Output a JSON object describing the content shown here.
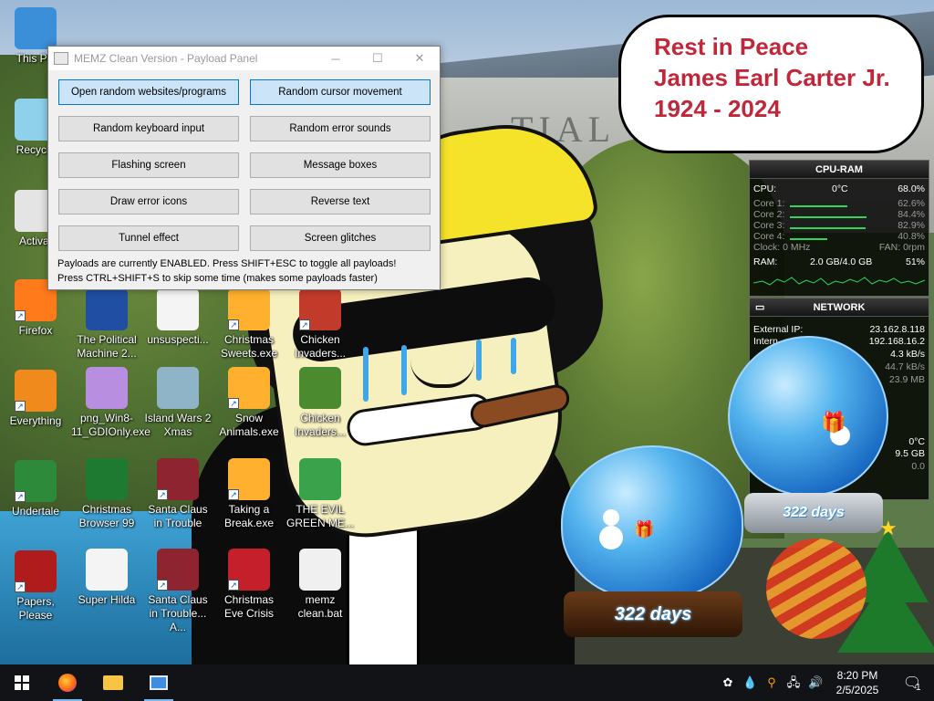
{
  "wallpaper": {
    "building_text": "TIAL",
    "bubble_lines": [
      "Rest in Peace",
      "James Earl Carter Jr.",
      "1924 - 2024"
    ]
  },
  "window": {
    "title": "MEMZ Clean Version - Payload Panel",
    "buttons": [
      {
        "label": "Open random websites/programs",
        "active": true
      },
      {
        "label": "Random cursor movement",
        "active": true
      },
      {
        "label": "Random keyboard input",
        "active": false
      },
      {
        "label": "Random error sounds",
        "active": false
      },
      {
        "label": "Flashing screen",
        "active": false
      },
      {
        "label": "Message boxes",
        "active": false
      },
      {
        "label": "Draw error icons",
        "active": false
      },
      {
        "label": "Reverse text",
        "active": false
      },
      {
        "label": "Tunnel effect",
        "active": false
      },
      {
        "label": "Screen glitches",
        "active": false
      }
    ],
    "status_line_1": "Payloads are currently ENABLED. Press SHIFT+ESC to toggle all payloads!",
    "status_line_2": "Press CTRL+SHIFT+S to skip some time (makes some payloads faster)"
  },
  "desktop_icons": [
    {
      "label": "This PC",
      "color": "#3a8fd8"
    },
    {
      "label": "Recycle",
      "color": "#8fd0ea"
    },
    {
      "label": "Activat",
      "color": "#e4e4e4"
    },
    {
      "label": "Firefox",
      "color": "#ff7a1a"
    },
    {
      "label": "Everything",
      "color": "#f08a1c"
    },
    {
      "label": "Undertale",
      "color": "#2d8a3a"
    },
    {
      "label": "Papers, Please",
      "color": "#b01c1c"
    },
    {
      "label": "The Political Machine 2...",
      "color": "#1f4ea3"
    },
    {
      "label": "unsuspecti...",
      "color": "#f4f4f4"
    },
    {
      "label": "Christmas Sweets.exe",
      "color": "#ffb02e"
    },
    {
      "label": "Chicken Invaders...",
      "color": "#c23b2a"
    },
    {
      "label": "png_Win8-11_GDIOnly.exe",
      "color": "#b78ee0"
    },
    {
      "label": "Island Wars 2 Xmas",
      "color": "#8fb4c8"
    },
    {
      "label": "Snow Animals.exe",
      "color": "#ffb02e"
    },
    {
      "label": "Chicken Invaders...",
      "color": "#4c8a2f"
    },
    {
      "label": "Christmas Browser 99",
      "color": "#1e7a30"
    },
    {
      "label": "Santa Claus in Trouble",
      "color": "#8f2431"
    },
    {
      "label": "Taking a Break.exe",
      "color": "#ffb02e"
    },
    {
      "label": "THE EVIL GREEN ME...",
      "color": "#3aa24b"
    },
    {
      "label": "Super Hilda",
      "color": "#f4f4f4"
    },
    {
      "label": "Santa Claus in Trouble... A...",
      "color": "#8f2431"
    },
    {
      "label": "Christmas Eve Crisis",
      "color": "#c41f2a"
    },
    {
      "label": "memz clean.bat",
      "color": "#f0f0f0"
    }
  ],
  "cpu_gadget": {
    "title": "CPU-RAM",
    "cpu_label": "CPU:",
    "cpu_temp": "0°C",
    "cpu_value": "68.0%",
    "cores": [
      {
        "label": "Core 1:",
        "value": "62.6%",
        "level": 0.626
      },
      {
        "label": "Core 2:",
        "value": "84.4%",
        "level": 0.844
      },
      {
        "label": "Core 3:",
        "value": "82.9%",
        "level": 0.829
      },
      {
        "label": "Core 4:",
        "value": "40.8%",
        "level": 0.408
      }
    ],
    "clock": "Clock: 0 MHz",
    "fan": "FAN: 0rpm",
    "ram_label": "RAM:",
    "ram_used": "2.0 GB/4.0 GB",
    "ram_value": "51%"
  },
  "network_gadget": {
    "title": "NETWORK",
    "external_ip_label": "External IP:",
    "external_ip": "23.162.8.118",
    "internal_label": "Intern",
    "internal_ip": "192.168.16.2",
    "speed_1": "4.3 kB/s",
    "speed_2": "44.7 kB/s",
    "speed_3": "23.9 MB",
    "temp": "0°C",
    "storage": "9.5 GB",
    "extra": "0.0"
  },
  "snow_globe_1_days": "322 days",
  "snow_globe_2_days": "322 days",
  "taskbar": {
    "time": "8:20 PM",
    "date": "2/5/2025",
    "notification_count": "1"
  }
}
